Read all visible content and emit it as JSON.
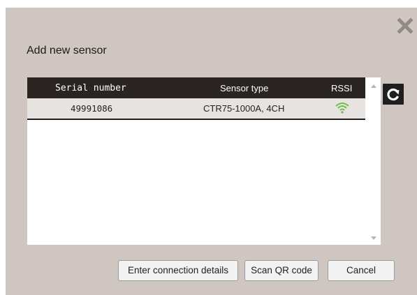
{
  "dialog": {
    "title": "Add new sensor"
  },
  "table": {
    "columns": [
      "Serial number",
      "Sensor type",
      "RSSI"
    ],
    "rows": [
      {
        "serial": "49991086",
        "type": "CTR75-1000A, 4CH",
        "rssi_icon": "wifi-signal-icon"
      }
    ]
  },
  "buttons": {
    "connect_label": "Enter connection details",
    "qr_label": "Scan QR code",
    "cancel_label": "Cancel"
  },
  "colors": {
    "dialog_bg": "#cfc5c1",
    "header_bg": "#2a2522",
    "signal_green": "#6cc04a"
  },
  "icons": {
    "close": "close-icon",
    "refresh": "refresh-icon"
  }
}
